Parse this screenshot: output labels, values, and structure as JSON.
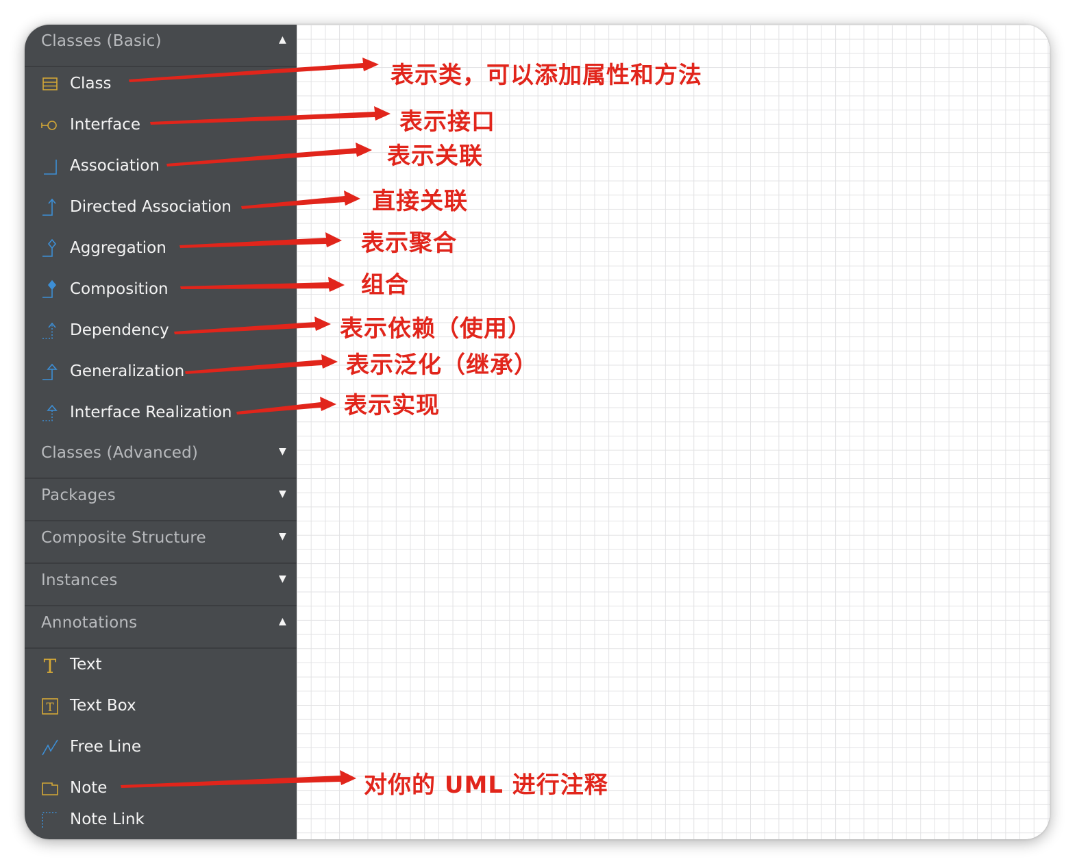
{
  "sections": {
    "classes_basic": {
      "title": "Classes (Basic)",
      "state_icon": "triangle-up-icon"
    },
    "classes_advanced": {
      "title": "Classes (Advanced)",
      "state_icon": "triangle-down-icon"
    },
    "packages": {
      "title": "Packages",
      "state_icon": "triangle-down-icon"
    },
    "composite_structure": {
      "title": "Composite Structure",
      "state_icon": "triangle-down-icon"
    },
    "instances": {
      "title": "Instances",
      "state_icon": "triangle-down-icon"
    },
    "annotations": {
      "title": "Annotations",
      "state_icon": "triangle-up-icon"
    }
  },
  "classes_basic_items": [
    {
      "label": "Class",
      "icon": "class-icon"
    },
    {
      "label": "Interface",
      "icon": "interface-icon"
    },
    {
      "label": "Association",
      "icon": "association-icon"
    },
    {
      "label": "Directed Association",
      "icon": "directed-association-icon"
    },
    {
      "label": "Aggregation",
      "icon": "aggregation-icon"
    },
    {
      "label": "Composition",
      "icon": "composition-icon"
    },
    {
      "label": "Dependency",
      "icon": "dependency-icon"
    },
    {
      "label": "Generalization",
      "icon": "generalization-icon"
    },
    {
      "label": "Interface Realization",
      "icon": "interface-realization-icon"
    }
  ],
  "annotation_items": [
    {
      "label": "Text",
      "icon": "text-icon"
    },
    {
      "label": "Text Box",
      "icon": "text-box-icon"
    },
    {
      "label": "Free Line",
      "icon": "free-line-icon"
    },
    {
      "label": "Note",
      "icon": "note-icon"
    },
    {
      "label": "Note Link",
      "icon": "note-link-icon"
    }
  ],
  "annotations": [
    "表示类，可以添加属性和方法",
    "表示接口",
    "表示关联",
    "直接关联",
    "表示聚合",
    "组合",
    "表示依赖（使用）",
    "表示泛化（继承）",
    "表示实现",
    "对你的 UML 进行注释"
  ],
  "colors": {
    "sidebar_bg": "#474a4d",
    "annotation_red": "#e1251b",
    "icon_gold": "#d4a837",
    "icon_blue": "#3d8fd6"
  }
}
